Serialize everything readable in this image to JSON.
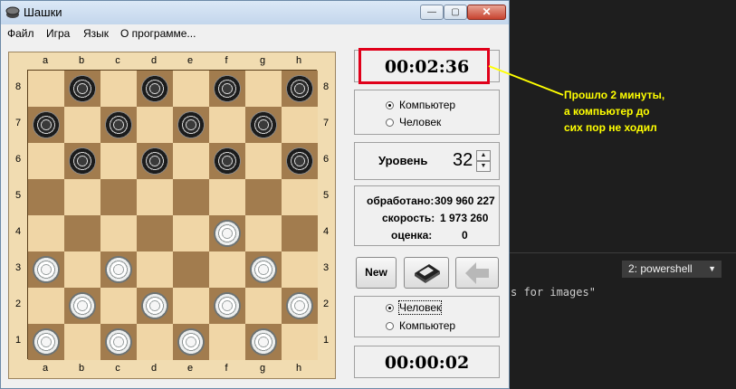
{
  "window": {
    "title": "Шашки"
  },
  "menu": [
    "Файл",
    "Игра",
    "Язык",
    "О программе..."
  ],
  "board": {
    "files": [
      "a",
      "b",
      "c",
      "d",
      "e",
      "f",
      "g",
      "h"
    ],
    "ranks": [
      "8",
      "7",
      "6",
      "5",
      "4",
      "3",
      "2",
      "1"
    ],
    "pieces": [
      {
        "sq": "b8",
        "color": "black"
      },
      {
        "sq": "d8",
        "color": "black"
      },
      {
        "sq": "f8",
        "color": "black"
      },
      {
        "sq": "h8",
        "color": "black"
      },
      {
        "sq": "a7",
        "color": "black"
      },
      {
        "sq": "c7",
        "color": "black"
      },
      {
        "sq": "e7",
        "color": "black"
      },
      {
        "sq": "g7",
        "color": "black"
      },
      {
        "sq": "b6",
        "color": "black"
      },
      {
        "sq": "d6",
        "color": "black"
      },
      {
        "sq": "f6",
        "color": "black"
      },
      {
        "sq": "h6",
        "color": "black"
      },
      {
        "sq": "f4",
        "color": "white"
      },
      {
        "sq": "a3",
        "color": "white"
      },
      {
        "sq": "c3",
        "color": "white"
      },
      {
        "sq": "g3",
        "color": "white"
      },
      {
        "sq": "b2",
        "color": "white"
      },
      {
        "sq": "d2",
        "color": "white"
      },
      {
        "sq": "f2",
        "color": "white"
      },
      {
        "sq": "h2",
        "color": "white"
      },
      {
        "sq": "a1",
        "color": "white"
      },
      {
        "sq": "c1",
        "color": "white"
      },
      {
        "sq": "e1",
        "color": "white"
      },
      {
        "sq": "g1",
        "color": "white"
      }
    ]
  },
  "top_player": {
    "timer": "00:02:36",
    "options": [
      {
        "label": "Компьютер",
        "selected": true
      },
      {
        "label": "Человек",
        "selected": false
      }
    ]
  },
  "level": {
    "label": "Уровень",
    "value": "32"
  },
  "stats": {
    "processed_label": "обработано:",
    "processed_value": "309 960 227",
    "speed_label": "скорость:",
    "speed_value": "1 973 260",
    "score_label": "оценка:",
    "score_value": "0"
  },
  "buttons": {
    "new_label": "New"
  },
  "bottom_player": {
    "timer": "00:00:02",
    "options": [
      {
        "label": "Человек",
        "selected": true
      },
      {
        "label": "Компьютер",
        "selected": false
      }
    ]
  },
  "annotation": {
    "lines": [
      "Прошло 2 минуты,",
      "а компьютер до",
      "сих пор не ходил"
    ]
  },
  "terminal": {
    "dropdown": "2: powershell",
    "text": "s for images\""
  },
  "colors": {
    "highlight": "#e0001a",
    "annotation": "#ffff00"
  }
}
